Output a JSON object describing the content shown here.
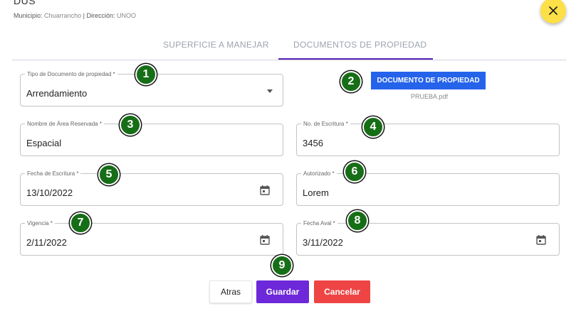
{
  "header": {
    "title": "DUS",
    "municipio_label": "Municipio:",
    "municipio_value": "Chuarrancho",
    "separator": "|",
    "direccion_label": "Dirección:",
    "direccion_value": "UNOO"
  },
  "tabs": [
    {
      "label": "SUPERFICIE A MANEJAR",
      "active": false
    },
    {
      "label": "DOCUMENTOS DE PROPIEDAD",
      "active": true
    }
  ],
  "form": {
    "tipo_documento": {
      "label": "Tipo de Documento de propiedad *",
      "value": "Arrendamiento"
    },
    "documento_button": {
      "label": "DOCUMENTO DE PROPIEDAD",
      "file": "PRUEBA.pdf"
    },
    "nombre_area": {
      "label": "Nombre de Área Reservada *",
      "value": "Espacial"
    },
    "no_escritura": {
      "label": "No. de Escritura *",
      "value": "3456"
    },
    "fecha_escritura": {
      "label": "Fecha de Escritura *",
      "value": "13/10/2022"
    },
    "autorizado": {
      "label": "Autorizado *",
      "value": "Lorem"
    },
    "vigencia": {
      "label": "Vigencia *",
      "value": "2/11/2022"
    },
    "fecha_aval": {
      "label": "Fecha Aval *",
      "value": "3/11/2022"
    }
  },
  "markers": [
    "1",
    "2",
    "3",
    "4",
    "5",
    "6",
    "7",
    "8",
    "9"
  ],
  "buttons": {
    "atras": "Atras",
    "guardar": "Guardar",
    "cancelar": "Cancelar"
  },
  "colors": {
    "primary": "#6d28d9",
    "doc_button": "#2563eb",
    "cancel": "#ef4444",
    "close": "#fde047",
    "marker": "#166e16"
  }
}
